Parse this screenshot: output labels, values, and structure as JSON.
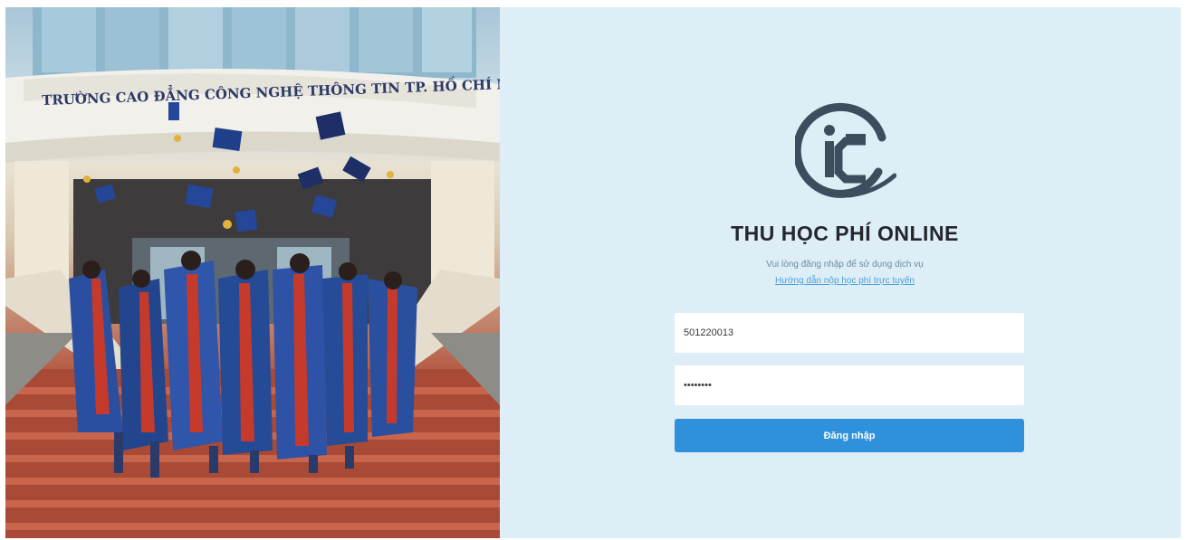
{
  "photo": {
    "school_sign": "TRƯỜNG CAO ĐẲNG CÔNG NGHỆ THÔNG TIN TP. HỒ CHÍ MINH"
  },
  "login": {
    "title": "THU HỌC PHÍ ONLINE",
    "subtitle": "Vui lòng đăng nhập để sử dụng dịch vụ",
    "guide_link": "Hướng dẫn nộp học phí trực tuyến",
    "username_value": "501220013",
    "password_value": "••••••••",
    "submit_label": "Đăng nhập"
  },
  "colors": {
    "panel_background": "#ddeef7",
    "accent": "#2f91dc",
    "title_text": "#24262c",
    "link": "#4a9ed7"
  },
  "icons": {
    "logo": "itc-logo-icon"
  }
}
